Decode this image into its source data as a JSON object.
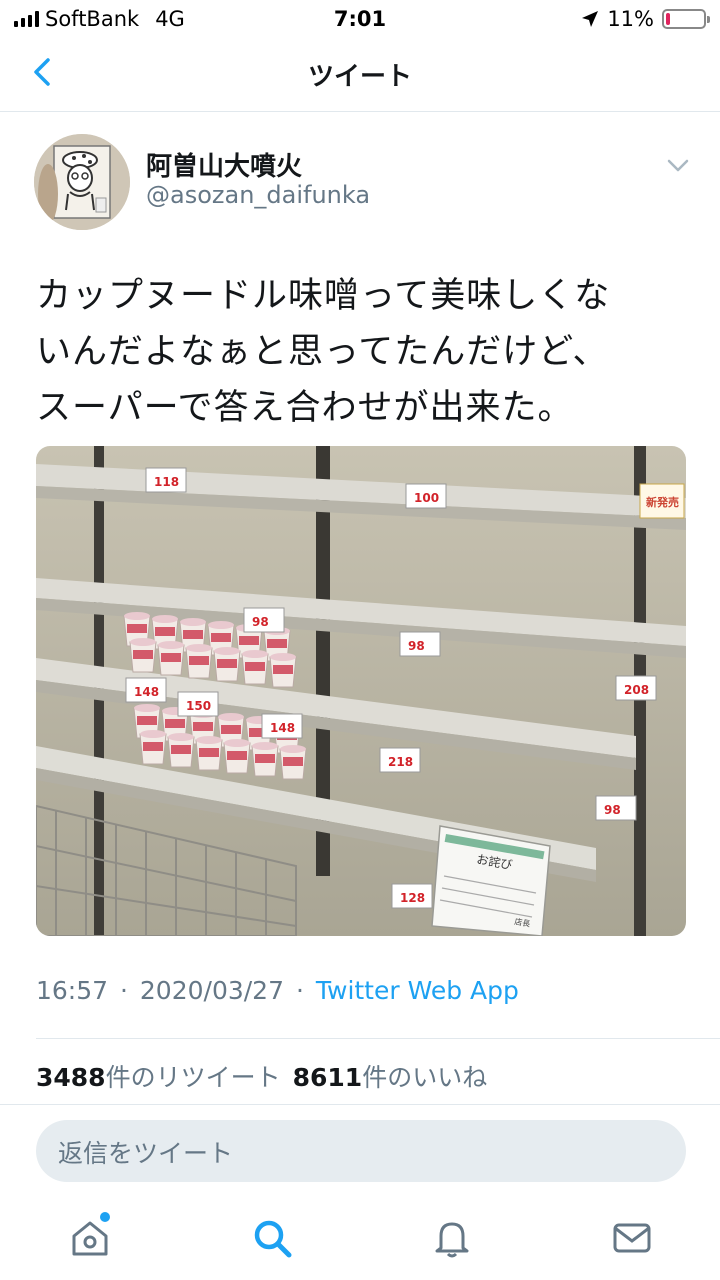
{
  "status_bar": {
    "carrier": "SoftBank",
    "network": "4G",
    "time": "7:01",
    "battery": "11%",
    "battery_level": 0.11
  },
  "header": {
    "title": "ツイート"
  },
  "tweet": {
    "display_name": "阿曽山大噴火",
    "handle": "@asozan_daifunka",
    "text": "カップヌードル味噌って美味しくな\nいんだよなぁと思ってたんだけど、\nスーパーで答え合わせが出来た。",
    "timestamp_time": "16:57",
    "timestamp_sep": "·",
    "timestamp_date": "2020/03/27",
    "source": "Twitter Web App",
    "retweets_count": "3488",
    "retweets_label": "件のリツイート",
    "likes_count": "8611",
    "likes_label": "件のいいね",
    "photo": {
      "price_tags": [
        "118",
        "100",
        "98",
        "98",
        "148",
        "150",
        "208",
        "148",
        "218",
        "98",
        "128"
      ],
      "tag_new": "新発売",
      "notice_title": "お詫び",
      "notice_footer": "店長"
    }
  },
  "reply": {
    "placeholder": "返信をツイート"
  },
  "colors": {
    "accent": "#1da1f2",
    "text": "#14171a",
    "muted": "#657786",
    "battery_low": "#e0245e"
  },
  "tab_bar": {
    "icons": [
      "home-icon",
      "search-icon",
      "notifications-icon",
      "messages-icon"
    ]
  }
}
